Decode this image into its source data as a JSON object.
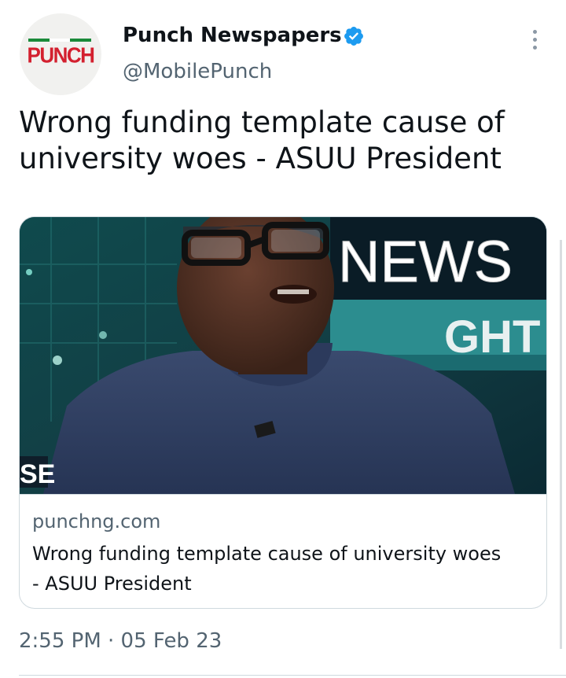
{
  "author": {
    "name": "Punch Newspapers",
    "handle": "@MobilePunch",
    "verified": true,
    "avatar_logo_text": "PUNCH"
  },
  "tweet": {
    "text": "Wrong funding template cause of university woes - ASUU President"
  },
  "link_card": {
    "image_overlay": {
      "banner_top": "NEWS",
      "banner_bottom": "GHT",
      "corner_text": "SE"
    },
    "domain": "punchng.com",
    "title": "Wrong funding template cause of university woes - ASUU President"
  },
  "meta": {
    "timestamp": "2:55 PM · 05 Feb 23"
  },
  "colors": {
    "text_primary": "#0f1419",
    "text_secondary": "#536471",
    "verified_blue": "#1d9bf0",
    "punch_red": "#d3202f",
    "border": "#cfd9de"
  },
  "icons": {
    "verified": "verified-badge-icon",
    "more": "more-options-icon"
  }
}
